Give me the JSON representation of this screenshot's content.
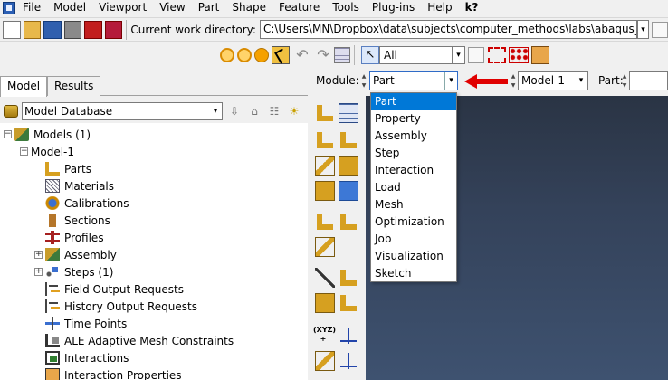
{
  "menubar": {
    "items": [
      {
        "label": "File"
      },
      {
        "label": "Model"
      },
      {
        "label": "Viewport"
      },
      {
        "label": "View"
      },
      {
        "label": "Part"
      },
      {
        "label": "Shape"
      },
      {
        "label": "Feature"
      },
      {
        "label": "Tools"
      },
      {
        "label": "Plug-ins"
      },
      {
        "label": "Help"
      }
    ],
    "help_pointer": "k?"
  },
  "toolbar": {
    "cwd_label": "Current work directory:",
    "cwd_value": "C:\\Users\\MN\\Dropbox\\data\\subjects\\computer_methods\\labs\\abaqus_cae",
    "selection_filter": "All"
  },
  "left_panel": {
    "tabs": [
      {
        "label": "Model",
        "active": true
      },
      {
        "label": "Results",
        "active": false
      }
    ],
    "database_label": "Model Database",
    "tree": [
      {
        "label": "Models (1)",
        "icon": "models-icon"
      },
      {
        "label": "Model-1",
        "icon": ""
      },
      {
        "label": "Parts",
        "icon": "parts-icon"
      },
      {
        "label": "Materials",
        "icon": "materials-icon"
      },
      {
        "label": "Calibrations",
        "icon": "calibrations-icon"
      },
      {
        "label": "Sections",
        "icon": "sections-icon"
      },
      {
        "label": "Profiles",
        "icon": "profiles-icon"
      },
      {
        "label": "Assembly",
        "icon": "assembly-icon"
      },
      {
        "label": "Steps (1)",
        "icon": "steps-icon"
      },
      {
        "label": "Field Output Requests",
        "icon": "field-output-icon"
      },
      {
        "label": "History Output Requests",
        "icon": "history-output-icon"
      },
      {
        "label": "Time Points",
        "icon": "time-points-icon"
      },
      {
        "label": "ALE Adaptive Mesh Constraints",
        "icon": "ale-mesh-icon"
      },
      {
        "label": "Interactions",
        "icon": "interactions-icon"
      },
      {
        "label": "Interaction Properties",
        "icon": "interaction-properties-icon"
      }
    ]
  },
  "module_bar": {
    "module_label": "Module:",
    "module_value": "Part",
    "model_value": "Model-1",
    "part_label": "Part:"
  },
  "module_dropdown": {
    "selected": "Part",
    "options": [
      "Part",
      "Property",
      "Assembly",
      "Step",
      "Interaction",
      "Load",
      "Mesh",
      "Optimization",
      "Job",
      "Visualization",
      "Sketch"
    ]
  },
  "colors": {
    "accent": "#0078d7",
    "arrow": "#e00000",
    "viewport_top": "#2a3444",
    "viewport_bottom": "#3e5270"
  }
}
